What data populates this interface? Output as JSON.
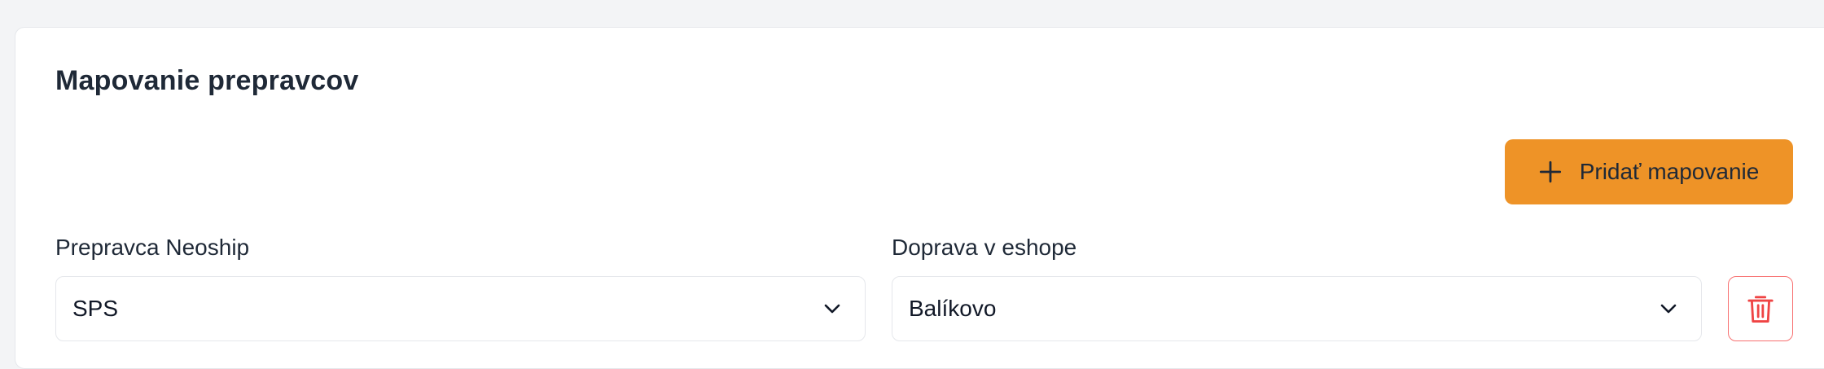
{
  "section": {
    "title": "Mapovanie prepravcov"
  },
  "toolbar": {
    "add_label": "Pridať mapovanie",
    "add_icon": "plus-icon",
    "accent_color": "#ee9327"
  },
  "mapping_row": {
    "carrier": {
      "label": "Prepravca Neoship",
      "value": "SPS",
      "icon": "chevron-down-icon"
    },
    "shipping": {
      "label": "Doprava v eshope",
      "value": "Balíkovo",
      "icon": "chevron-down-icon"
    },
    "delete_icon": "trash-icon",
    "delete_color": "#ef4444"
  }
}
